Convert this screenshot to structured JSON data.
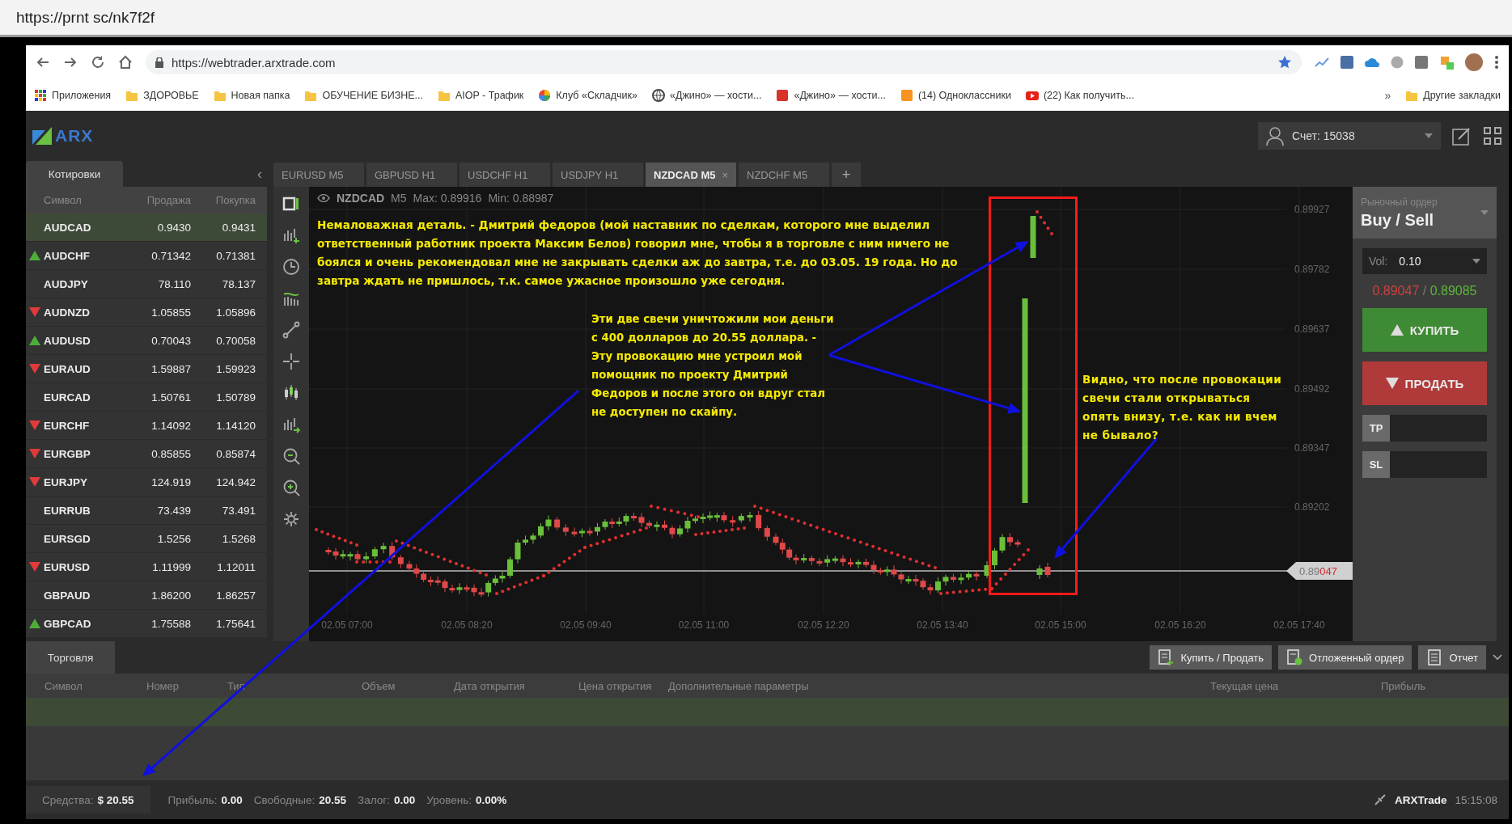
{
  "screenshot_bar": {
    "url": "https://prnt sc/nk7f2f"
  },
  "browser": {
    "url": "https://webtrader.arxtrade.com",
    "bookmarks": [
      {
        "label": "Приложения",
        "kind": "apps"
      },
      {
        "label": "ЗДОРОВЬЕ",
        "kind": "folder"
      },
      {
        "label": "Новая папка",
        "kind": "folder"
      },
      {
        "label": "ОБУЧЕНИЕ БИЗНЕ...",
        "kind": "folder"
      },
      {
        "label": "AIOP - Трафик",
        "kind": "folder"
      },
      {
        "label": "Клуб «Складчик»",
        "kind": "ball"
      },
      {
        "label": "«Джино» — хости...",
        "kind": "globe"
      },
      {
        "label": "«Джино» — хости...",
        "kind": "site"
      },
      {
        "label": "(14) Одноклассники",
        "kind": "social"
      },
      {
        "label": "(22) Как получить...",
        "kind": "video"
      }
    ],
    "more": "»",
    "other": {
      "label": "Другие закладки",
      "kind": "folder"
    }
  },
  "app": {
    "logo": "ARX",
    "account": "Счет: 15038"
  },
  "quotes": {
    "tab": "Котировки",
    "collapse": "‹",
    "columns": [
      "Символ",
      "Продажа",
      "Покупка"
    ],
    "rows": [
      {
        "symbol": "AUDCAD",
        "sell": "0.9430",
        "buy": "0.9431",
        "kind": "flat",
        "selected": true
      },
      {
        "symbol": "AUDCHF",
        "sell": "0.71342",
        "buy": "0.71381",
        "kind": "up",
        "selected": false
      },
      {
        "symbol": "AUDJPY",
        "sell": "78.110",
        "buy": "78.137",
        "kind": "flat",
        "selected": false
      },
      {
        "symbol": "AUDNZD",
        "sell": "1.05855",
        "buy": "1.05896",
        "kind": "down",
        "selected": false
      },
      {
        "symbol": "AUDUSD",
        "sell": "0.70043",
        "buy": "0.70058",
        "kind": "up",
        "selected": false
      },
      {
        "symbol": "EURAUD",
        "sell": "1.59887",
        "buy": "1.59923",
        "kind": "down",
        "selected": false
      },
      {
        "symbol": "EURCAD",
        "sell": "1.50761",
        "buy": "1.50789",
        "kind": "flat",
        "selected": false
      },
      {
        "symbol": "EURCHF",
        "sell": "1.14092",
        "buy": "1.14120",
        "kind": "down",
        "selected": false
      },
      {
        "symbol": "EURGBP",
        "sell": "0.85855",
        "buy": "0.85874",
        "kind": "down",
        "selected": false
      },
      {
        "symbol": "EURJPY",
        "sell": "124.919",
        "buy": "124.942",
        "kind": "down",
        "selected": false
      },
      {
        "symbol": "EURRUB",
        "sell": "73.439",
        "buy": "73.491",
        "kind": "flat",
        "selected": false
      },
      {
        "symbol": "EURSGD",
        "sell": "1.5256",
        "buy": "1.5268",
        "kind": "flat",
        "selected": false
      },
      {
        "symbol": "EURUSD",
        "sell": "1.11999",
        "buy": "1.12011",
        "kind": "down",
        "selected": false
      },
      {
        "symbol": "GBPAUD",
        "sell": "1.86200",
        "buy": "1.86257",
        "kind": "flat",
        "selected": false
      },
      {
        "symbol": "GBPCAD",
        "sell": "1.75588",
        "buy": "1.75641",
        "kind": "up",
        "selected": false
      }
    ]
  },
  "chart_tabs": [
    {
      "label": "EURUSD M5",
      "selected": false
    },
    {
      "label": "GBPUSD H1",
      "selected": false
    },
    {
      "label": "USDCHF H1",
      "selected": false
    },
    {
      "label": "USDJPY H1",
      "selected": false
    },
    {
      "label": "NZDCAD M5",
      "selected": true,
      "close": "×"
    },
    {
      "label": "NZDCHF M5",
      "selected": false
    }
  ],
  "add_tab": "+",
  "chart": {
    "symbol": "NZDCAD",
    "timeframe": "M5",
    "max": "Max: 0.89916",
    "min": "Min: 0.88987",
    "price_labels": [
      "0.89927",
      "0.89782",
      "0.89637",
      "0.89492",
      "0.89347",
      "0.89202"
    ],
    "time_labels": [
      "02.05 07:00",
      "02.05 08:20",
      "02.05 09:40",
      "02.05 11:00",
      "02.05 12:20",
      "02.05 13:40",
      "02.05 15:00",
      "02.05 16:20",
      "02.05 17:40"
    ],
    "current_price": {
      "main": "0.89",
      "pips": "047"
    }
  },
  "order": {
    "type_label": "Рыночный ордер",
    "mode": "Buy / Sell",
    "volume_label": "Vol:",
    "volume": "0.10",
    "bid": "0.89047",
    "separator": "/",
    "ask": "0.89085",
    "buy": "КУПИТЬ",
    "sell": "ПРОДАТЬ",
    "tp": "TP",
    "sl": "SL"
  },
  "trading": {
    "tab": "Торговля",
    "buttons": [
      {
        "label": "Купить / Продать",
        "kind": "buy-sell"
      },
      {
        "label": "Отложенный ордер",
        "kind": "pending"
      },
      {
        "label": "Отчет",
        "kind": "report"
      }
    ],
    "columns": [
      "Символ",
      "Номер",
      "Тип",
      "Объем",
      "Дата открытия",
      "Цена открытия",
      "Дополнительные параметры",
      "Текущая цена",
      "Прибыль"
    ]
  },
  "status_bar": {
    "items": [
      {
        "label": "Средства:",
        "value": "$ 20.55",
        "kind": "boxed"
      },
      {
        "label": "Прибыль:",
        "value": "0.00",
        "kind": "plain"
      },
      {
        "label": "Свободные:",
        "value": "20.55",
        "kind": "plain"
      },
      {
        "label": "Залог:",
        "value": "0.00",
        "kind": "plain"
      },
      {
        "label": "Уровень:",
        "value": "0.00%",
        "kind": "plain"
      }
    ],
    "server": "ARXTrade",
    "time": "15:15:08"
  },
  "annotations": [
    {
      "kind": "top",
      "text": "Немаловажная деталь. - Дмитрий федоров (мой наставник по сделкам, которого мне выделил ответственный работник проекта Максим Белов) говорил мне, чтобы я в торговле с ним ничего не боялся и очень рекомендовал мне не закрывать сделки аж до завтра, т.е. до 03.05. 19 года. Но до завтра ждать не пришлось, т.к. самое ужасное произошло уже сегодня."
    },
    {
      "kind": "middle",
      "text": "Эти две свечи уничтожили мои деньги с 400 долларов до 20.55 доллара.  - Эту провокацию мне устроил мой помощник по проекту Дмитрий Федоров и после этого он вдруг стал не доступен по скайпу."
    },
    {
      "kind": "right",
      "text": "Видно, что после провокации свечи стали открываться опять внизу, т.е. как ни вчем не бывало?"
    }
  ]
}
